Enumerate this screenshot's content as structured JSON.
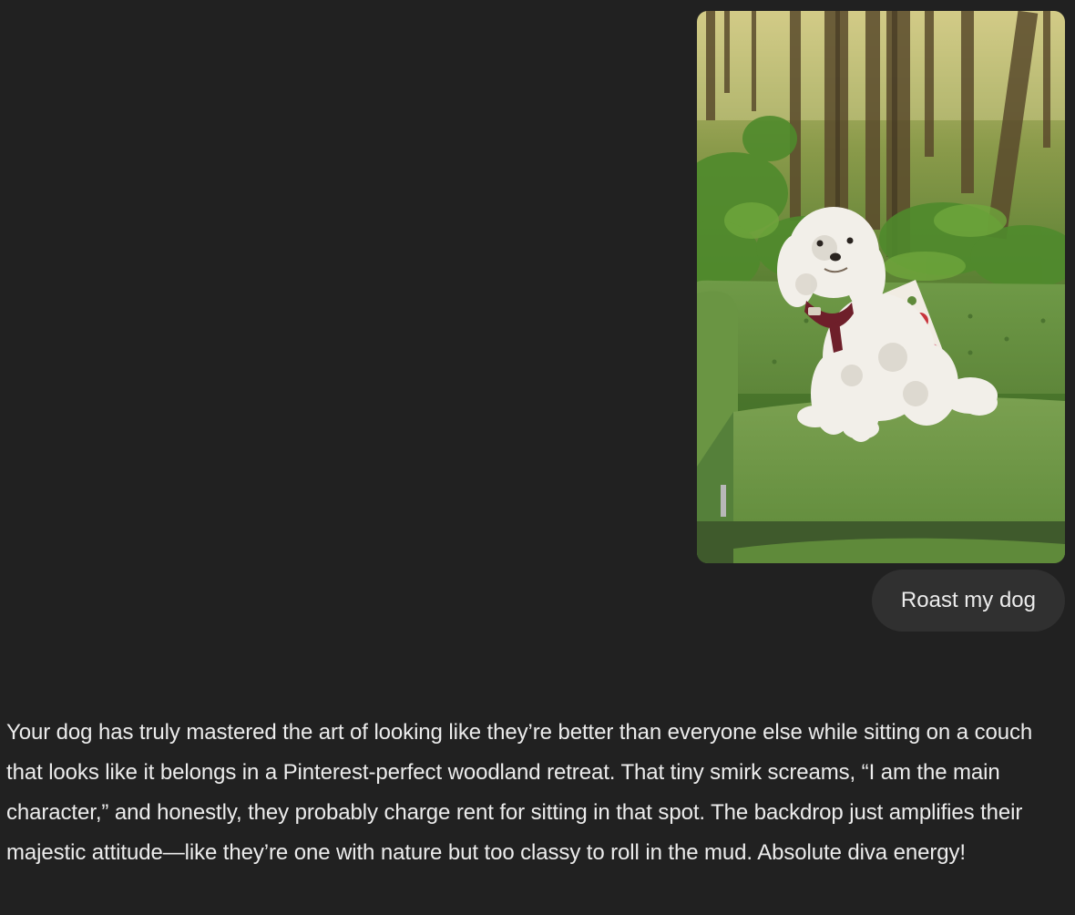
{
  "conversation": {
    "user_message": {
      "image_icon": "photo-dog-on-green-couch",
      "text": "Roast my dog"
    },
    "assistant_message": {
      "text": "Your dog has truly mastered the art of looking like they’re better than everyone else while sitting on a couch that looks like it belongs in a Pinterest-perfect woodland retreat. That tiny smirk screams, “I am the main character,” and honestly, they probably charge rent for sitting in that spot. The backdrop just amplifies their majestic attitude—like they’re one with nature but too classy to roll in the mud. Absolute diva energy!"
    }
  },
  "colors": {
    "background": "#212121",
    "user_bubble": "#303030",
    "text": "#ececec"
  }
}
